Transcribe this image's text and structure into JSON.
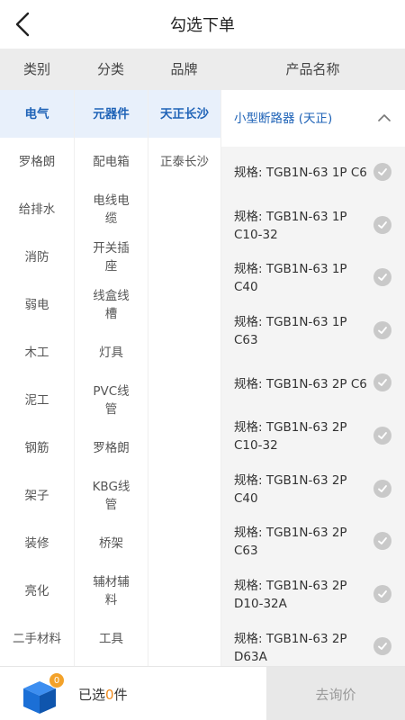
{
  "header": {
    "title": "勾选下单"
  },
  "columns": {
    "category": "类别",
    "classify": "分类",
    "brand": "品牌",
    "product_name": "产品名称"
  },
  "categories": [
    "电气",
    "罗格朗",
    "给排水",
    "消防",
    "弱电",
    "木工",
    "泥工",
    "钢筋",
    "架子",
    "装修",
    "亮化",
    "二手材料"
  ],
  "classifications": [
    "元器件",
    "配电箱",
    "电线电缆",
    "开关插座",
    "线盒线槽",
    "灯具",
    "PVC线管",
    "罗格朗",
    "KBG线管",
    "桥架",
    "辅材辅料",
    "工具"
  ],
  "brands": [
    "天正长沙",
    "正泰长沙"
  ],
  "product": {
    "name": "小型断路器 (天正)",
    "specs": [
      "规格: TGB1N-63 1P C6",
      "规格: TGB1N-63 1P C10-32",
      "规格: TGB1N-63 1P C40",
      "规格: TGB1N-63 1P C63",
      "规格: TGB1N-63 2P C6",
      "规格: TGB1N-63 2P C10-32",
      "规格: TGB1N-63 2P C40",
      "规格: TGB1N-63 2P C63",
      "规格: TGB1N-63 2P D10-32A",
      "规格: TGB1N-63 2P D63A"
    ]
  },
  "footer": {
    "badge_count": "0",
    "selected_prefix": "已选",
    "selected_count": "0",
    "selected_suffix": "件",
    "inquire_label": "去询价"
  },
  "colors": {
    "accent": "#1f63b7",
    "orange": "#f08a1c",
    "cart_blue": "#1b6fd6"
  },
  "icons": {
    "back": "chevron-left-icon",
    "collapse": "chevron-up-icon",
    "check": "check-circle-icon",
    "cart": "box-icon"
  }
}
